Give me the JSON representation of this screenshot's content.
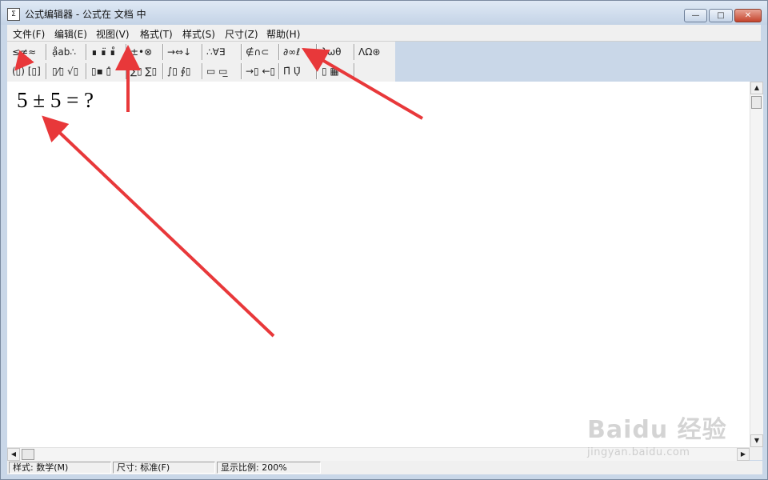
{
  "window": {
    "icon_text": "Σ",
    "title": "公式编辑器 - 公式在 文档 中",
    "buttons": {
      "minimize": "—",
      "maximize": "□",
      "close": "✕"
    }
  },
  "menu": [
    {
      "label": "文件(F)"
    },
    {
      "label": "编辑(E)"
    },
    {
      "label": "视图(V)"
    },
    {
      "label": "格式(T)"
    },
    {
      "label": "样式(S)"
    },
    {
      "label": "尺寸(Z)"
    },
    {
      "label": "帮助(H)"
    }
  ],
  "toolbar": {
    "row1": [
      {
        "label": "≤≠≈",
        "name": "relational-symbols-palette"
      },
      {
        "label": "ạ̊ab∴",
        "name": "spaces-ellipses-palette"
      },
      {
        "label": "∎ ∎̈ ∎̊",
        "name": "embellishments-palette"
      },
      {
        "label": "±•⊗",
        "name": "operator-symbols-palette"
      },
      {
        "label": "→⇔↓",
        "name": "arrow-symbols-palette"
      },
      {
        "label": "∴∀∃",
        "name": "logical-symbols-palette"
      },
      {
        "label": "∉∩⊂",
        "name": "set-theory-symbols-palette"
      },
      {
        "label": "∂∞ℓ",
        "name": "misc-symbols-palette"
      },
      {
        "label": "λωθ",
        "name": "greek-lowercase-palette"
      },
      {
        "label": "ΛΩ⊛",
        "name": "greek-uppercase-palette"
      }
    ],
    "row2": [
      {
        "label": "(▯) [▯]",
        "name": "fence-templates-palette"
      },
      {
        "label": "▯⁄▯ √▯",
        "name": "fraction-radical-templates-palette"
      },
      {
        "label": "▯▪ ▯̂",
        "name": "script-templates-palette"
      },
      {
        "label": "∑▯ ∑▯",
        "name": "summation-templates-palette"
      },
      {
        "label": "∫▯ ∮▯",
        "name": "integral-templates-palette"
      },
      {
        "label": "▭ ▭̲",
        "name": "underbar-overbar-templates-palette"
      },
      {
        "label": "→▯ ←▯",
        "name": "labeled-arrow-templates-palette"
      },
      {
        "label": "Π̄ Ụ̈",
        "name": "products-set-templates-palette"
      },
      {
        "label": "▯ ▦",
        "name": "matrix-templates-palette"
      }
    ]
  },
  "document": {
    "formula": "5 ± 5 = ?"
  },
  "scroll": {
    "up": "▲",
    "down": "▼",
    "left": "◀",
    "right": "▶"
  },
  "status": {
    "style": "样式: 数学(M)",
    "size": "尺寸: 标准(F)",
    "zoom": "显示比例: 200%"
  },
  "watermark": {
    "logo": "Baidu 经验",
    "url": "jingyan.baidu.com"
  },
  "colors": {
    "annotation_arrow": "#e8383a",
    "title_bar": "#c4d3e6",
    "close_button": "#c5442c"
  }
}
